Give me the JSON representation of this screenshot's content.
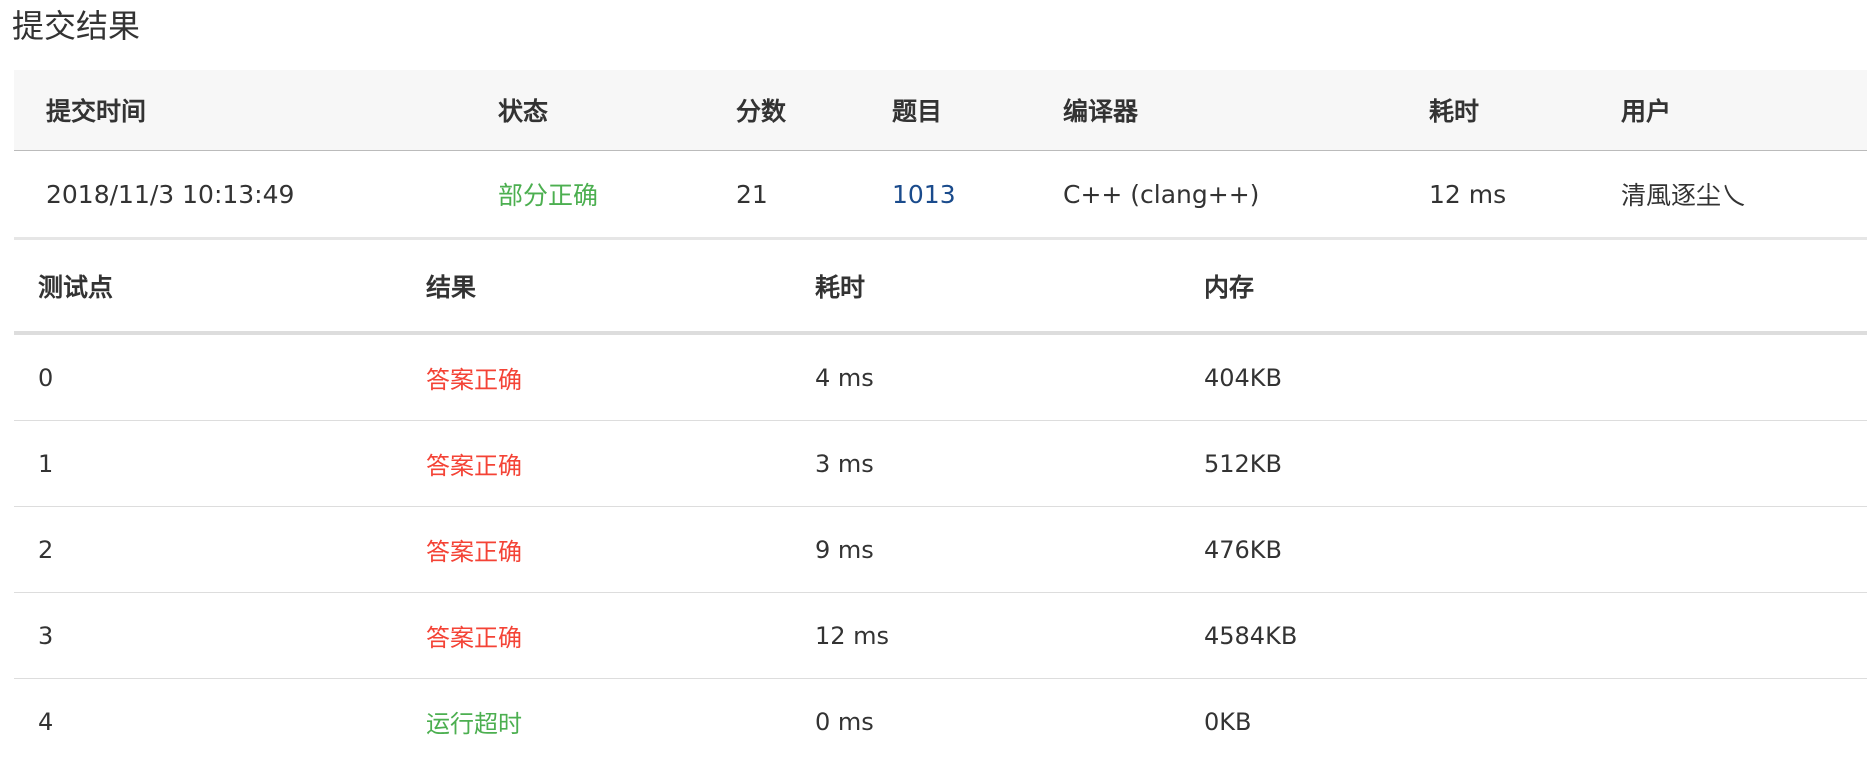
{
  "page_title": "提交结果",
  "colors": {
    "partial_status": "#4caf50",
    "correct_status": "#f44336",
    "timeout_status": "#4caf50",
    "link": "#1a4b8c",
    "header_bg": "#f7f7f7"
  },
  "summary": {
    "headers": {
      "time": "提交时间",
      "status": "状态",
      "score": "分数",
      "problem": "题目",
      "compiler": "编译器",
      "duration": "耗时",
      "user": "用户"
    },
    "row": {
      "time": "2018/11/3 10:13:49",
      "status": "部分正确",
      "score": "21",
      "problem": "1013",
      "compiler": "C++ (clang++)",
      "duration": "12 ms",
      "user": "清風逐尘乀"
    }
  },
  "cases": {
    "headers": {
      "id": "测试点",
      "result": "结果",
      "duration": "耗时",
      "memory": "内存"
    },
    "rows": [
      {
        "id": "0",
        "result": "答案正确",
        "duration": "4 ms",
        "memory": "404KB"
      },
      {
        "id": "1",
        "result": "答案正确",
        "duration": "3 ms",
        "memory": "512KB"
      },
      {
        "id": "2",
        "result": "答案正确",
        "duration": "9 ms",
        "memory": "476KB"
      },
      {
        "id": "3",
        "result": "答案正确",
        "duration": "12 ms",
        "memory": "4584KB"
      },
      {
        "id": "4",
        "result": "运行超时",
        "duration": "0 ms",
        "memory": "0KB"
      }
    ]
  }
}
